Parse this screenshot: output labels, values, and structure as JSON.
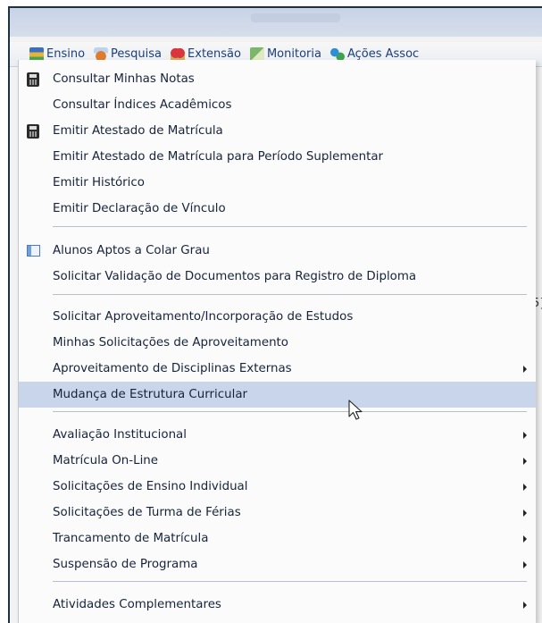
{
  "menubar": {
    "items": [
      {
        "label": "Ensino",
        "icon": "ensino-icon"
      },
      {
        "label": "Pesquisa",
        "icon": "pesquisa-icon"
      },
      {
        "label": "Extensão",
        "icon": "extensao-icon"
      },
      {
        "label": "Monitoria",
        "icon": "monitoria-icon"
      },
      {
        "label": "Ações Assoc",
        "icon": "acoes-icon"
      }
    ]
  },
  "dropdown": {
    "items": [
      {
        "label": "Consultar Minhas Notas",
        "icon": "calculator-icon",
        "submenu": false
      },
      {
        "label": "Consultar Índices Acadêmicos",
        "icon": "",
        "submenu": false
      },
      {
        "label": "Emitir Atestado de Matrícula",
        "icon": "calculator-icon",
        "submenu": false
      },
      {
        "label": "Emitir Atestado de Matrícula para Período Suplementar",
        "icon": "",
        "submenu": false
      },
      {
        "label": "Emitir Histórico",
        "icon": "",
        "submenu": false
      },
      {
        "label": "Emitir Declaração de Vínculo",
        "icon": "",
        "submenu": false
      },
      {
        "label": "Alunos Aptos a Colar Grau",
        "icon": "table-icon",
        "submenu": false
      },
      {
        "label": "Solicitar Validação de Documentos para Registro de Diploma",
        "icon": "",
        "submenu": false
      },
      {
        "label": "Solicitar Aproveitamento/Incorporação de Estudos",
        "icon": "",
        "submenu": false
      },
      {
        "label": "Minhas Solicitações de Aproveitamento",
        "icon": "",
        "submenu": false
      },
      {
        "label": "Aproveitamento de Disciplinas Externas",
        "icon": "",
        "submenu": true
      },
      {
        "label": "Mudança de Estrutura Curricular",
        "icon": "",
        "submenu": false,
        "active": true
      },
      {
        "label": "Avaliação Institucional",
        "icon": "",
        "submenu": true
      },
      {
        "label": "Matrícula On-Line",
        "icon": "",
        "submenu": true
      },
      {
        "label": "Solicitações de Ensino Individual",
        "icon": "",
        "submenu": true
      },
      {
        "label": "Solicitações de Turma de Férias",
        "icon": "",
        "submenu": true
      },
      {
        "label": "Trancamento de Matrícula",
        "icon": "",
        "submenu": true
      },
      {
        "label": "Suspensão de Programa",
        "icon": "",
        "submenu": true
      },
      {
        "label": "Atividades Complementares",
        "icon": "",
        "submenu": true
      }
    ]
  },
  "side_glyph": "5}",
  "colors": {
    "menubar_text": "#1c3f7a",
    "active_row": "#c8d5ea",
    "frame_border": "#1d2f4a"
  }
}
